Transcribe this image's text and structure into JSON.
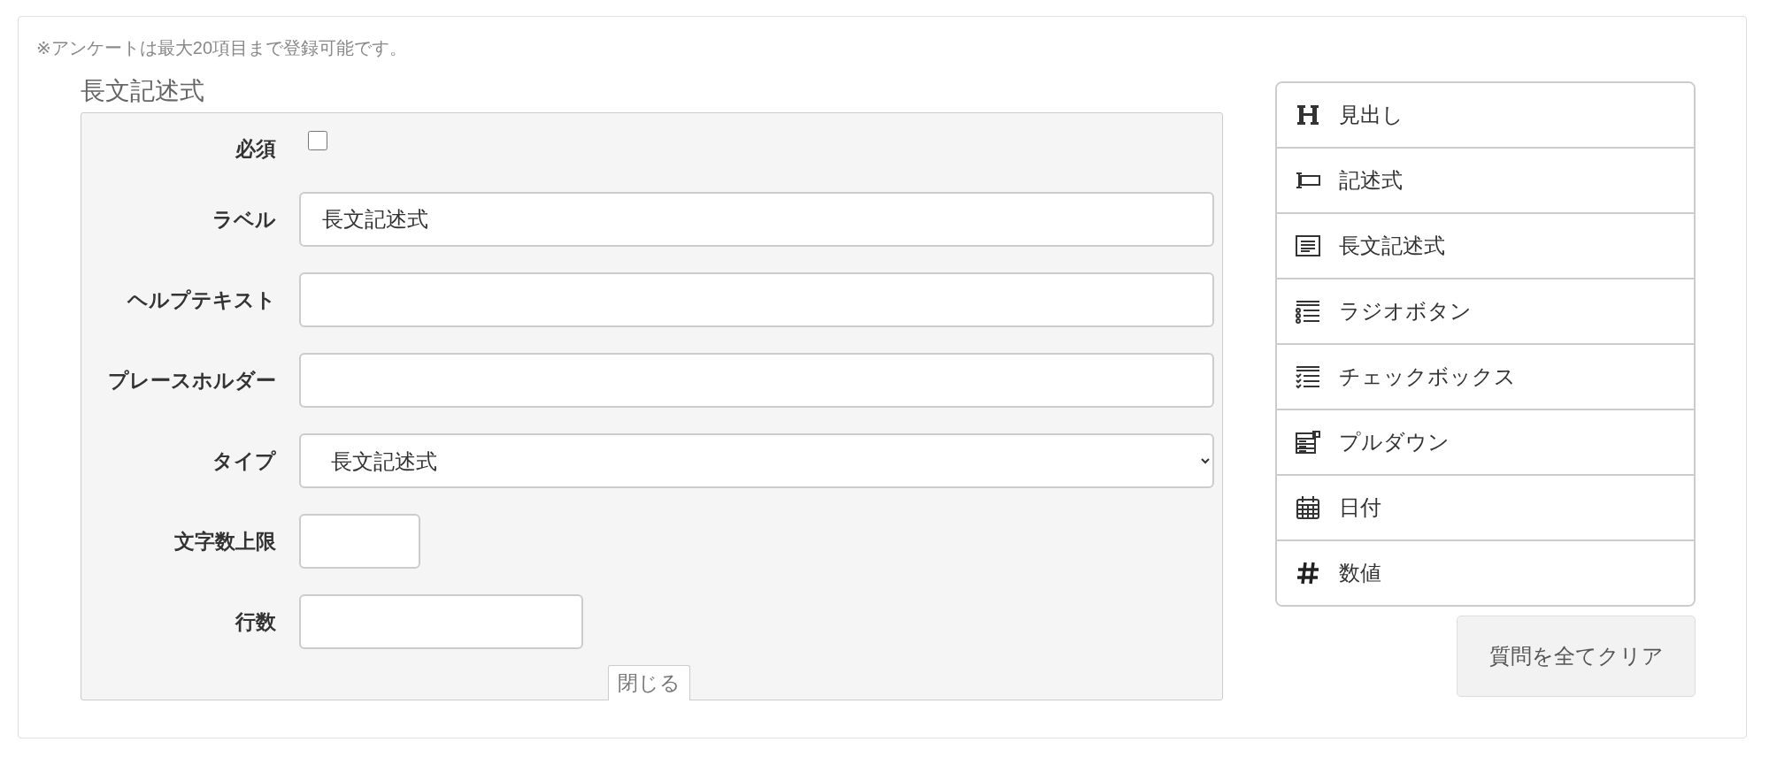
{
  "notice": "※アンケートは最大20項目まで登録可能です。",
  "editor": {
    "title": "長文記述式",
    "fields": [
      {
        "kind": "checkbox",
        "label": "必須",
        "checked": false
      },
      {
        "kind": "text",
        "label": "ラベル",
        "value": "長文記述式"
      },
      {
        "kind": "text",
        "label": "ヘルプテキスト"
      },
      {
        "kind": "text",
        "label": "プレースホルダー"
      },
      {
        "kind": "select",
        "label": "タイプ",
        "value": "長文記述式"
      },
      {
        "kind": "short-text",
        "label": "文字数上限"
      },
      {
        "kind": "medium-text",
        "label": "行数"
      }
    ],
    "close_tab": "閉じる"
  },
  "question_types": [
    {
      "kind": "heading",
      "label": "見出し"
    },
    {
      "kind": "text",
      "label": "記述式"
    },
    {
      "kind": "textarea",
      "label": "長文記述式"
    },
    {
      "kind": "radio",
      "label": "ラジオボタン"
    },
    {
      "kind": "checkbox",
      "label": "チェックボックス"
    },
    {
      "kind": "dropdown",
      "label": "プルダウン"
    },
    {
      "kind": "date",
      "label": "日付"
    },
    {
      "kind": "number",
      "label": "数値"
    }
  ],
  "clear_button": "質問を全てクリア"
}
